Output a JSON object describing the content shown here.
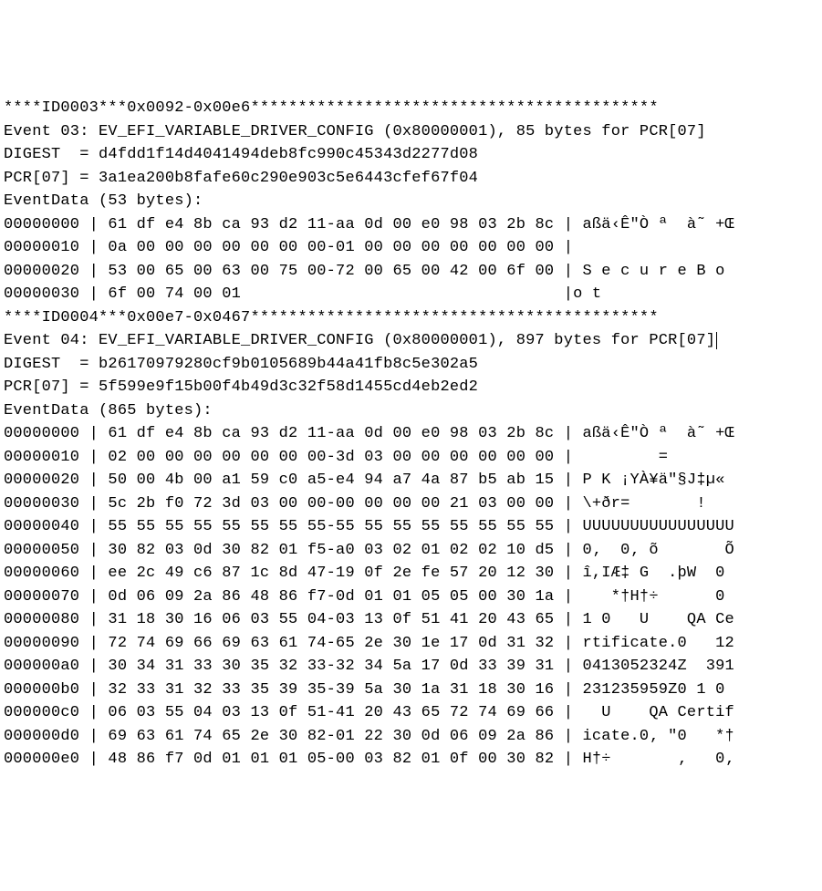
{
  "lines": [
    "****ID0003***0x0092-0x00e6*******************************************",
    "Event 03: EV_EFI_VARIABLE_DRIVER_CONFIG (0x80000001), 85 bytes for PCR[07]",
    "DIGEST  = d4fdd1f14d4041494deb8fc990c45343d2277d08",
    "PCR[07] = 3a1ea200b8fafe60c290e903c5e6443cfef67f04",
    "EventData (53 bytes):",
    "00000000 | 61 df e4 8b ca 93 d2 11-aa 0d 00 e0 98 03 2b 8c | aßä‹Ê\"Ò ª  à˜ +Œ",
    "00000010 | 0a 00 00 00 00 00 00 00-01 00 00 00 00 00 00 00 |",
    "00000020 | 53 00 65 00 63 00 75 00-72 00 65 00 42 00 6f 00 | S e c u r e B o",
    "00000030 | 6f 00 74 00 01                                  |o t",
    "****ID0004***0x00e7-0x0467*******************************************",
    "Event 04: EV_EFI_VARIABLE_DRIVER_CONFIG (0x80000001), 897 bytes for PCR[07]",
    "DIGEST  = b26170979280cf9b0105689b44a41fb8c5e302a5",
    "PCR[07] = 5f599e9f15b00f4b49d3c32f58d1455cd4eb2ed2",
    "EventData (865 bytes):",
    "00000000 | 61 df e4 8b ca 93 d2 11-aa 0d 00 e0 98 03 2b 8c | aßä‹Ê\"Ò ª  à˜ +Œ",
    "00000010 | 02 00 00 00 00 00 00 00-3d 03 00 00 00 00 00 00 |         =",
    "00000020 | 50 00 4b 00 a1 59 c0 a5-e4 94 a7 4a 87 b5 ab 15 | P K ¡YÀ¥ä\"§J‡µ«",
    "00000030 | 5c 2b f0 72 3d 03 00 00-00 00 00 00 21 03 00 00 | \\+ðr=       !",
    "00000040 | 55 55 55 55 55 55 55 55-55 55 55 55 55 55 55 55 | UUUUUUUUUUUUUUUU",
    "00000050 | 30 82 03 0d 30 82 01 f5-a0 03 02 01 02 02 10 d5 | 0‚  0‚ õ       Õ",
    "00000060 | ee 2c 49 c6 87 1c 8d 47-19 0f 2e fe 57 20 12 30 | î,IÆ‡ G  .þW  0",
    "00000070 | 0d 06 09 2a 86 48 86 f7-0d 01 01 05 05 00 30 1a |    *†H†÷      0",
    "00000080 | 31 18 30 16 06 03 55 04-03 13 0f 51 41 20 43 65 | 1 0   U    QA Ce",
    "00000090 | 72 74 69 66 69 63 61 74-65 2e 30 1e 17 0d 31 32 | rtificate.0   12",
    "000000a0 | 30 34 31 33 30 35 32 33-32 34 5a 17 0d 33 39 31 | 0413052324Z  391",
    "000000b0 | 32 33 31 32 33 35 39 35-39 5a 30 1a 31 18 30 16 | 231235959Z0 1 0",
    "000000c0 | 06 03 55 04 03 13 0f 51-41 20 43 65 72 74 69 66 |   U    QA Certif",
    "000000d0 | 69 63 61 74 65 2e 30 82-01 22 30 0d 06 09 2a 86 | icate.0‚ \"0   *†",
    "000000e0 | 48 86 f7 0d 01 01 01 05-00 03 82 01 0f 00 30 82 | H†÷       ‚   0‚"
  ],
  "cursor_line_index": 10
}
